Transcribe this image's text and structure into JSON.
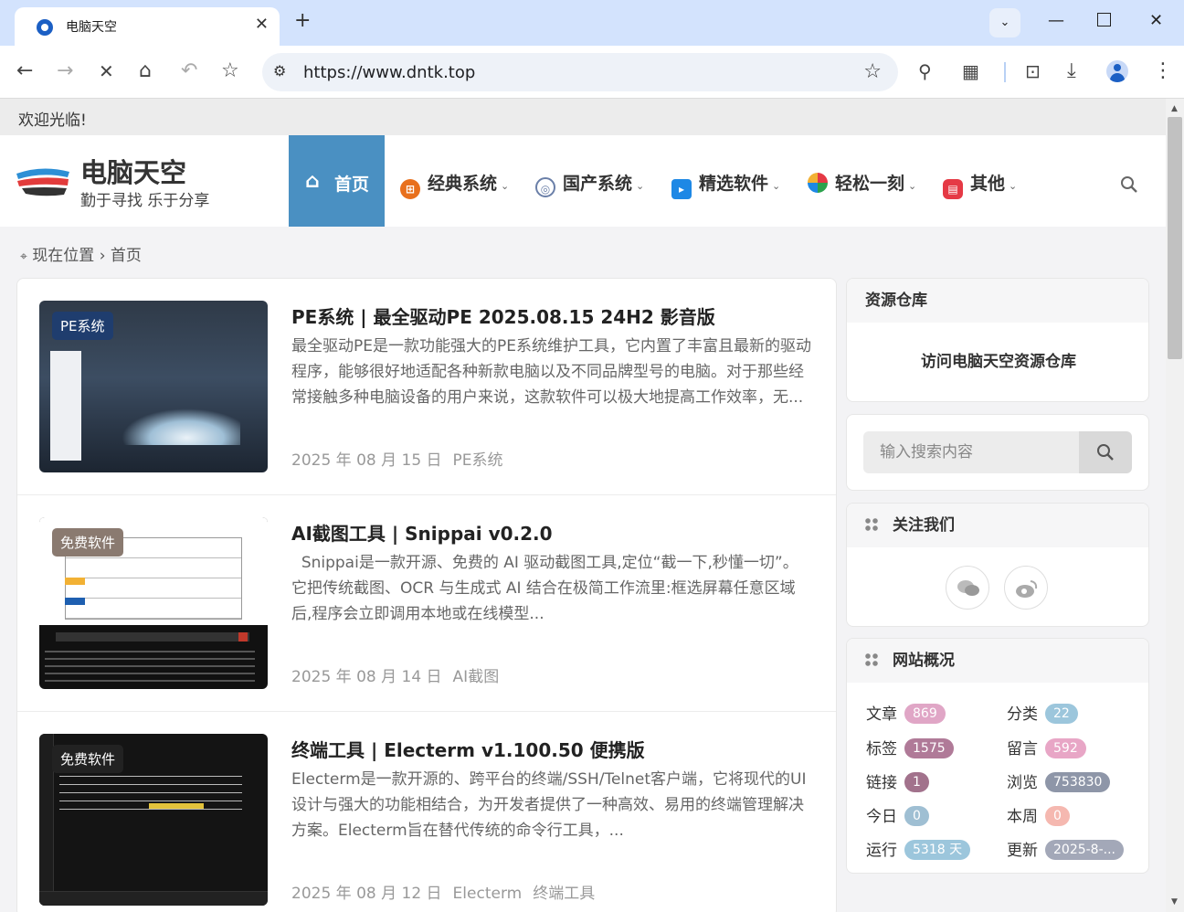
{
  "browser": {
    "tab_title": "电脑天空",
    "url": "https://www.dntk.top"
  },
  "page": {
    "welcome": "欢迎光临!",
    "site_name": "电脑天空",
    "site_slogan": "勤于寻找 乐于分享",
    "nav": [
      {
        "label": "首页",
        "icon": "home-icon",
        "active": true
      },
      {
        "label": "经典系统",
        "icon": "windows-icon",
        "color": "#e8701d"
      },
      {
        "label": "国产系统",
        "icon": "disc-icon",
        "color": "#6a7fa8"
      },
      {
        "label": "精选软件",
        "icon": "software-icon",
        "color": "#1e88e5"
      },
      {
        "label": "轻松一刻",
        "icon": "pinwheel-icon",
        "color": "#f2b134"
      },
      {
        "label": "其他",
        "icon": "calendar-icon",
        "color": "#e53945"
      }
    ],
    "breadcrumb": {
      "location": "现在位置",
      "current": "首页"
    },
    "articles": [
      {
        "tag": "PE系统",
        "tag_color": "#1f3d6e",
        "title": "PE系统 | 最全驱动PE 2025.08.15 24H2 影音版",
        "excerpt": "最全驱动PE是一款功能强大的PE系统维护工具，它内置了丰富且最新的驱动程序，能够很好地适配各种新款电脑以及不同品牌型号的电脑。对于那些经常接触多种电脑设备的用户来说，这款软件可以极大地提高工作效率，无...",
        "date": "2025 年 08 月 15 日",
        "categories": [
          "PE系统"
        ]
      },
      {
        "tag": "免费软件",
        "tag_color": "#8a7a70",
        "title": "AI截图工具 | Snippai v0.2.0",
        "excerpt": "  Snippai是一款开源、免费的 AI 驱动截图工具,定位“截一下,秒懂一切”。它把传统截图、OCR 与生成式 AI 结合在极简工作流里:框选屏幕任意区域后,程序会立即调用本地或在线模型...",
        "date": "2025 年 08 月 14 日",
        "categories": [
          "AI截图"
        ]
      },
      {
        "tag": "免费软件",
        "tag_color": "#222222",
        "title": "终端工具 | Electerm v1.100.50 便携版",
        "excerpt": "Electerm是一款开源的、跨平台的终端/SSH/Telnet客户端，它将现代的UI设计与强大的功能相结合，为开发者提供了一种高效、易用的终端管理解决方案。Electerm旨在替代传统的命令行工具，...",
        "date": "2025 年 08 月 12 日",
        "categories": [
          "Electerm",
          "终端工具"
        ]
      }
    ],
    "sidebar": {
      "repo_title": "资源仓库",
      "repo_link": "访问电脑天空资源仓库",
      "search_placeholder": "输入搜索内容",
      "follow_title": "关注我们",
      "stats_title": "网站概况",
      "stats": [
        {
          "label": "文章",
          "value": "869",
          "color": "#e0a6c6"
        },
        {
          "label": "分类",
          "value": "22",
          "color": "#9cc6dc"
        },
        {
          "label": "标签",
          "value": "1575",
          "color": "#b07a98"
        },
        {
          "label": "留言",
          "value": "592",
          "color": "#e8a6c6"
        },
        {
          "label": "链接",
          "value": "1",
          "color": "#a2728c"
        },
        {
          "label": "浏览",
          "value": "753830",
          "color": "#8e96a8"
        },
        {
          "label": "今日",
          "value": "0",
          "color": "#9fbfd3"
        },
        {
          "label": "本周",
          "value": "0",
          "color": "#f5b8b0"
        },
        {
          "label": "运行",
          "value": "5318 天",
          "color": "#9cc6dc"
        },
        {
          "label": "更新",
          "value": "2025-8-...",
          "color": "#a3a8b8"
        }
      ]
    }
  }
}
